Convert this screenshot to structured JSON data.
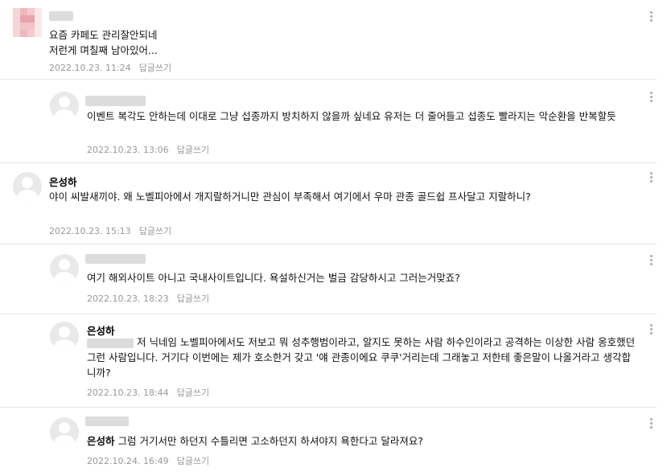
{
  "comments": [
    {
      "text": "요즘 카페도 관리잘안되네\n저런게 며칠째 남아있어...",
      "date": "2022.10.23. 11:24",
      "reply": "답글쓰기"
    },
    {
      "text": "이벤트 복각도 안하는데 이대로 그냥 섭종까지 방치하지 않을까 싶네요 유저는 더 줄어들고 섭종도 빨라지는 악순환을 반복할듯",
      "date": "2022.10.23. 13:06",
      "reply": "답글쓰기"
    },
    {
      "name": "은성하",
      "text": "야이 씨발새끼야. 왜 노벨피아에서 개지랄하거니만 관심이 부족해서 여기에서 우마 관종 골드쉽 프사달고 지랄하니?",
      "date": "2022.10.23. 15:13",
      "reply": "답글쓰기"
    },
    {
      "text": "여기 해외사이트 아니고 국내사이트입니다. 욕설하신거는 벌금 감당하시고 그러는거맞죠?",
      "date": "2022.10.23. 18:23",
      "reply": "답글쓰기"
    },
    {
      "name": "은성하",
      "text": "저 닉네임 노벨피아에서도 저보고 뭐 성추행범이라고, 알지도 못하는 사람 하수인이라고 공격하는 이상한 사람 옹호했던 그런 사람입니다. 거기다 이번에는 제가 호소한거 갖고 '얘 관종이에요 쿠쿠'거리는데 그래놓고 저한테 좋은말이 나올거라고 생각합니까?",
      "date": "2022.10.23. 18:44",
      "reply": "답글쓰기"
    },
    {
      "mention": "은성하",
      "text": "그럼 거기서만 하던지 수틀리면 고소하던지 하셔야지 욕한다고 달라져요?",
      "date": "2022.10.24. 16:49",
      "reply": "답글쓰기"
    }
  ]
}
